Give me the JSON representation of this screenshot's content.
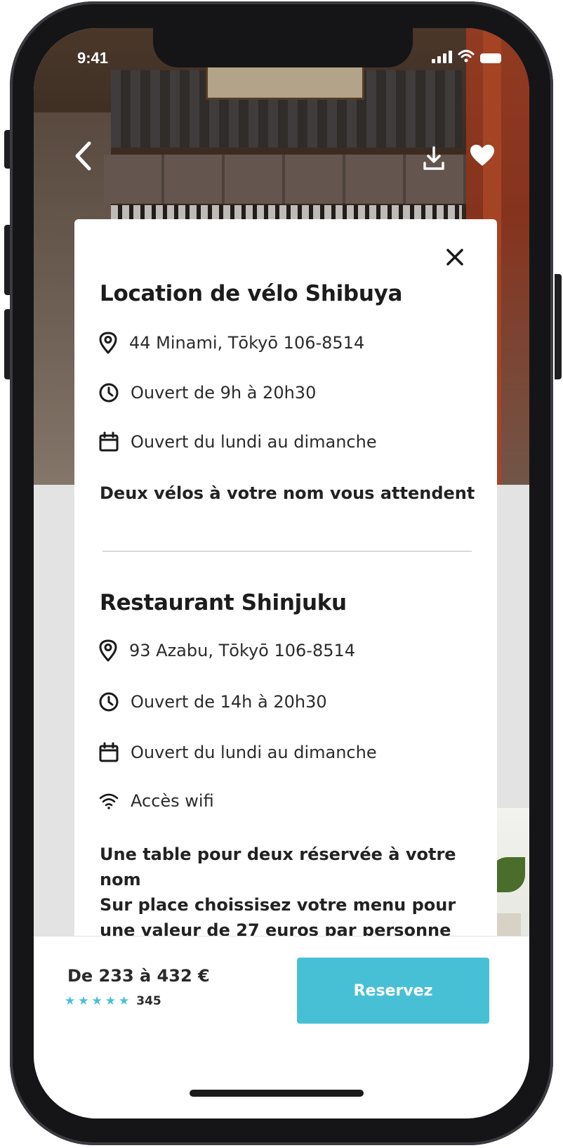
{
  "status_bar": {
    "time": "9:41"
  },
  "header": {
    "back_icon": "chevron-left-icon",
    "download_icon": "download-icon",
    "favorite_icon": "heart-icon"
  },
  "modal": {
    "close_icon": "close-icon",
    "sections": [
      {
        "title": "Location de vélo Shibuya",
        "address": "44 Minami, Tōkyō 106-8514",
        "hours": "Ouvert de 9h à 20h30",
        "days": "Ouvert du lundi au dimanche",
        "note": "Deux vélos à votre nom vous attendent"
      },
      {
        "title": "Restaurant Shinjuku",
        "address": "93 Azabu, Tōkyō 106-8514",
        "hours": "Ouvert de 14h à 20h30",
        "days": "Ouvert du lundi au dimanche",
        "wifi": "Accès wifi",
        "note_line1": "Une table pour deux réservée à votre nom",
        "note_line2": "Sur place choissisez votre menu pour",
        "note_line3": "une valeur de 27 euros par personne"
      }
    ]
  },
  "footer": {
    "price": "De 233 à 432 €",
    "rating_stars": 5,
    "rating_count": "345",
    "book_label": "Reservez"
  },
  "colors": {
    "accent": "#47c0d6",
    "text": "#1c1c1c"
  }
}
